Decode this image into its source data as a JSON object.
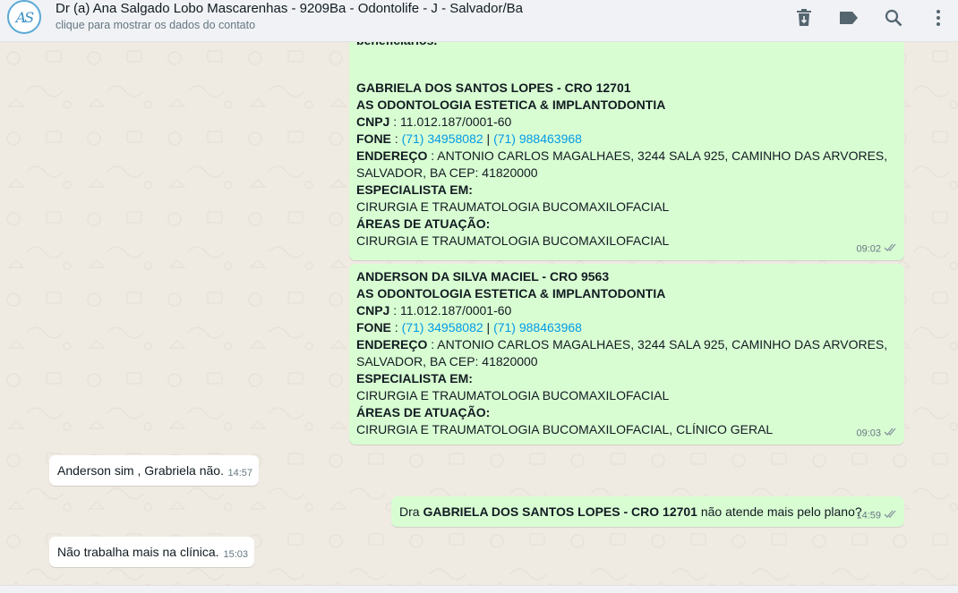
{
  "header": {
    "avatar_initials": "AS",
    "contact_name": "Dr (a) Ana Salgado Lobo Mascarenhas - 9209Ba - Odontolife - J - Salvador/Ba",
    "contact_subtitle": "clique para mostrar os dados do contato",
    "icons": [
      "delete-icon",
      "label-icon",
      "search-icon",
      "menu-icon"
    ]
  },
  "messages": {
    "m1": {
      "partial_top": "beneficiarios.",
      "name": "GABRIELA DOS SANTOS LOPES - CRO 12701",
      "company": "AS ODONTOLOGIA ESTETICA & IMPLANTODONTIA",
      "cnpj_label": "CNPJ",
      "cnpj_value": " : 11.012.187/0001-60",
      "fone_label": "FONE",
      "fone_sep1": " : ",
      "phone1": "(71) 34958082",
      "fone_sep2": " | ",
      "phone2": "(71) 988463968",
      "endereco_label": "ENDEREÇO",
      "endereco_line1": " : ANTONIO CARLOS MAGALHAES, 3244 SALA 925, CAMINHO DAS ARVORES,",
      "endereco_line2": "SALVADOR, BA CEP: 41820000",
      "especialista_label": "ESPECIALISTA EM:",
      "especialista_value": "CIRURGIA E TRAUMATOLOGIA BUCOMAXILOFACIAL",
      "areas_label": "ÁREAS DE ATUAÇÃO:",
      "areas_value": "CIRURGIA E TRAUMATOLOGIA BUCOMAXILOFACIAL",
      "time": "09:02"
    },
    "m2": {
      "name": "ANDERSON DA SILVA MACIEL - CRO 9563",
      "company": "AS ODONTOLOGIA ESTETICA & IMPLANTODONTIA",
      "cnpj_label": "CNPJ",
      "cnpj_value": " : 11.012.187/0001-60",
      "fone_label": "FONE",
      "fone_sep1": " : ",
      "phone1": "(71) 34958082",
      "fone_sep2": " | ",
      "phone2": "(71) 988463968",
      "endereco_label": "ENDEREÇO",
      "endereco_line1": " : ANTONIO CARLOS MAGALHAES, 3244 SALA 925, CAMINHO DAS ARVORES,",
      "endereco_line2": "SALVADOR, BA CEP: 41820000",
      "especialista_label": "ESPECIALISTA EM:",
      "especialista_value": "CIRURGIA E TRAUMATOLOGIA BUCOMAXILOFACIAL",
      "areas_label": "ÁREAS DE ATUAÇÃO:",
      "areas_value": "CIRURGIA E TRAUMATOLOGIA BUCOMAXILOFACIAL, CLÍNICO GERAL",
      "time": "09:03"
    },
    "m3": {
      "text": "Anderson sim , Grabriela não.",
      "time": "14:57"
    },
    "m4": {
      "prefix": "Dra ",
      "bold": "GABRIELA DOS SANTOS LOPES - CRO 12701",
      "suffix": " não atende mais pelo plano?",
      "time": "14:59"
    },
    "m5": {
      "text": "Não trabalha mais na clínica.",
      "time": "15:03"
    }
  },
  "colors": {
    "outgoing_bubble": "#d9fdd3",
    "incoming_bubble": "#ffffff",
    "chat_background": "#efeae2",
    "link": "#039be5",
    "read_ticks": "#8696a0"
  }
}
